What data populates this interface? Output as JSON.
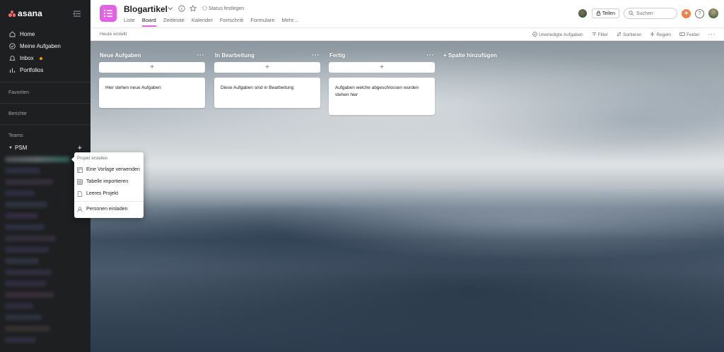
{
  "sidebar": {
    "logo_text": "asana",
    "nav": [
      {
        "label": "Home",
        "icon": "home-icon"
      },
      {
        "label": "Meine Aufgaben",
        "icon": "check-circle-icon"
      },
      {
        "label": "Inbox",
        "icon": "bell-icon"
      },
      {
        "label": "Portfolios",
        "icon": "bar-chart-icon"
      }
    ],
    "sections": {
      "favorites": "Favoriten",
      "reports": "Berichte",
      "teams": "Teams"
    },
    "team_name": "PSM"
  },
  "header": {
    "project_title": "Blogartikel",
    "status_label": "Status festlegen",
    "tabs": [
      "Liste",
      "Board",
      "Zeitleiste",
      "Kalender",
      "Fortschritt",
      "Formulare",
      "Mehr..."
    ],
    "active_tab": "Board",
    "share_label": "Teilen",
    "search_placeholder": "Suchen"
  },
  "toolbar": {
    "created_today": "Heute erstellt",
    "incomplete_tasks": "Unerledigte Aufgaben",
    "filter": "Filter",
    "sort": "Sortieren",
    "rules": "Regeln",
    "fields": "Felder"
  },
  "board": {
    "columns": [
      {
        "title": "Neue Aufgaben",
        "card": "Hier stehen neue Aufgaben"
      },
      {
        "title": "In Bearbeitung",
        "card": "Diese Aufgaben sind in Bearbeitung"
      },
      {
        "title": "Fertig",
        "card": "Aufgaben welche abgeschlossen wurden stehen hier"
      }
    ],
    "add_column": "+ Spalte hinzufügen"
  },
  "menu": {
    "header": "Projekt erstellen",
    "items": [
      {
        "label": "Eine Vorlage verwenden",
        "icon": "template-icon"
      },
      {
        "label": "Tabelle importieren",
        "icon": "table-icon"
      },
      {
        "label": "Leeres Projekt",
        "icon": "document-icon"
      },
      {
        "label": "Personen einladen",
        "icon": "person-icon"
      }
    ]
  },
  "colors": {
    "sidebar_bg": "#1e1f21",
    "project_accent": "#e362e3",
    "brand_coral": "#f06a6a",
    "add_button": "#f1814b",
    "inbox_badge": "#fd9a00"
  }
}
